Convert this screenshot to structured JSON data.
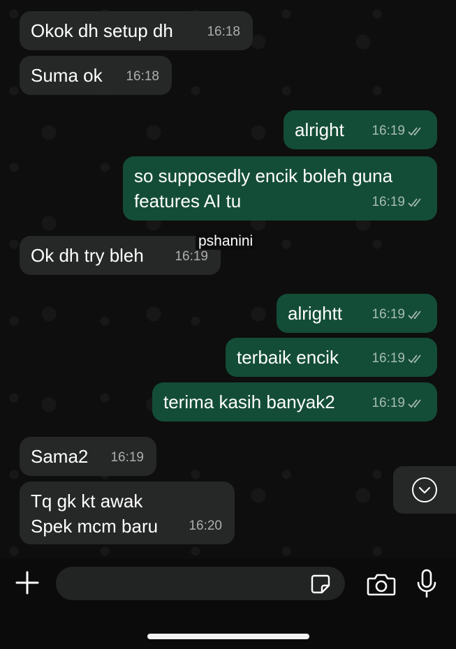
{
  "messages": [
    {
      "text": "Okok dh setup dh",
      "time": "16:18",
      "direction": "incoming"
    },
    {
      "text": "Suma ok",
      "time": "16:18",
      "direction": "incoming"
    },
    {
      "text": "alright",
      "time": "16:19",
      "direction": "outgoing",
      "status": "read"
    },
    {
      "text": "so supposedly encik boleh guna\nfeatures AI tu",
      "time": "16:19",
      "direction": "outgoing",
      "status": "read"
    },
    {
      "text": "Ok dh try bleh",
      "time": "16:19",
      "direction": "incoming"
    },
    {
      "text": "alrightt",
      "time": "16:19",
      "direction": "outgoing",
      "status": "read"
    },
    {
      "text": "terbaik encik",
      "time": "16:19",
      "direction": "outgoing",
      "status": "read"
    },
    {
      "text": "terima kasih banyak2",
      "time": "16:19",
      "direction": "outgoing",
      "status": "read"
    },
    {
      "text": "Sama2",
      "time": "16:19",
      "direction": "incoming"
    },
    {
      "text": "Tq gk kt awak\nSpek mcm baru",
      "time": "16:20",
      "direction": "incoming"
    }
  ],
  "overlay_username": "pshanini",
  "composer": {
    "placeholder": "",
    "icons": [
      "plus-icon",
      "sticker-icon",
      "camera-icon",
      "microphone-icon"
    ]
  },
  "scroll_button_icon": "chevron-down-icon",
  "colors": {
    "background": "#0b0c0b",
    "incoming_bubble": "#262727",
    "outgoing_bubble": "#144d37",
    "timestamp": "#a6a6a6",
    "input_field": "#222323"
  }
}
